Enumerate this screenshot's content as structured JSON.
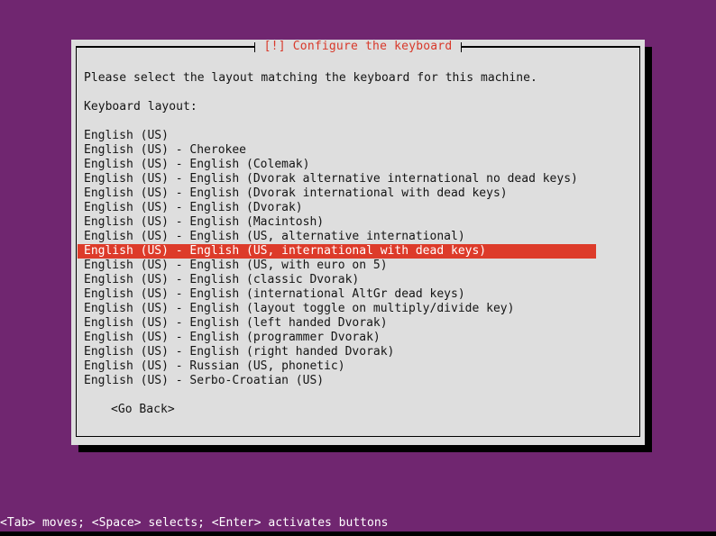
{
  "screen": {
    "background_color": "#702670",
    "text_color": "#ffffff"
  },
  "window": {
    "title": "[!] Configure the keyboard",
    "title_color": "#d8392a",
    "background_color": "#dedede",
    "prompt": "Please select the layout matching the keyboard for this machine.",
    "field_label": "Keyboard layout:",
    "highlight_color": "#dd3b2a",
    "selected_index": 9,
    "layouts": [
      "English (US)",
      "English (US) - Cherokee",
      "English (US) - English (Colemak)",
      "English (US) - English (Dvorak alternative international no dead keys)",
      "English (US) - English (Dvorak international with dead keys)",
      "English (US) - English (Dvorak)",
      "English (US) - English (Macintosh)",
      "English (US) - English (US, alternative international)",
      "English (US) - English (US, international with dead keys)",
      "English (US) - English (US, with euro on 5)",
      "English (US) - English (classic Dvorak)",
      "English (US) - English (international AltGr dead keys)",
      "English (US) - English (layout toggle on multiply/divide key)",
      "English (US) - English (left handed Dvorak)",
      "English (US) - English (programmer Dvorak)",
      "English (US) - English (right handed Dvorak)",
      "English (US) - Russian (US, phonetic)",
      "English (US) - Serbo-Croatian (US)"
    ],
    "go_back_button": "<Go Back>"
  },
  "status_bar": {
    "hint": "<Tab> moves; <Space> selects; <Enter> activates buttons"
  }
}
